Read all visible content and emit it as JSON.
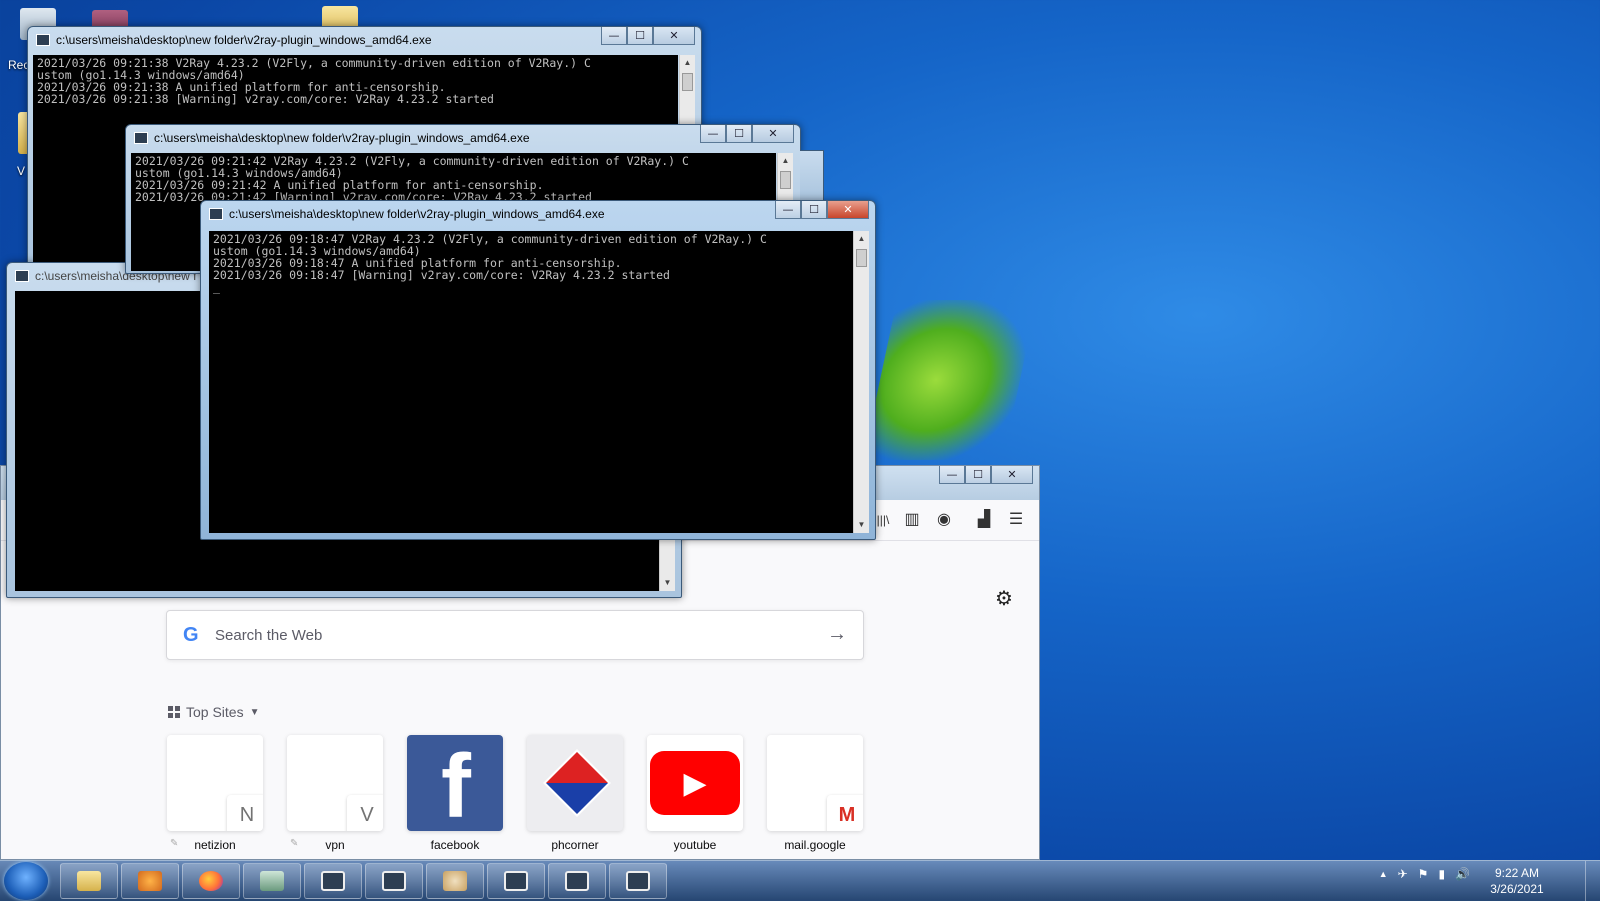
{
  "desktop": {
    "icon_labels": [
      "Rec",
      "V"
    ]
  },
  "console_windows": [
    {
      "title": "c:\\users\\meisha\\desktop\\new folder\\v2ray-plugin_windows_amd64.exe",
      "lines": [
        "2021/03/26 09:21:38 V2Ray 4.23.2 (V2Fly, a community-driven edition of V2Ray.) C",
        "ustom (go1.14.3 windows/amd64)",
        "2021/03/26 09:21:38 A unified platform for anti-censorship.",
        "2021/03/26 09:21:38 [Warning] v2ray.com/core: V2Ray 4.23.2 started"
      ]
    },
    {
      "title": "c:\\users\\meisha\\desktop\\new folder\\v2ray-plugin_windows_amd64.exe",
      "lines": [
        "2021/03/26 09:21:42 V2Ray 4.23.2 (V2Fly, a community-driven edition of V2Ray.) C",
        "ustom (go1.14.3 windows/amd64)",
        "2021/03/26 09:21:42 A unified platform for anti-censorship.",
        "2021/03/26 09:21:42 [Warning] v2ray.com/core: V2Ray 4.23.2 started"
      ]
    },
    {
      "title": "c:\\users\\meisha\\desktop\\new f",
      "lines": []
    },
    {
      "title": "c:\\users\\meisha\\desktop\\new folder\\v2ray-plugin_windows_amd64.exe",
      "lines": [
        "2021/03/26 09:18:47 V2Ray 4.23.2 (V2Fly, a community-driven edition of V2Ray.) C",
        "ustom (go1.14.3 windows/amd64)",
        "2021/03/26 09:18:47 A unified platform for anti-censorship.",
        "2021/03/26 09:18:47 [Warning] v2ray.com/core: V2Ray 4.23.2 started",
        "_"
      ]
    }
  ],
  "window_buttons": {
    "minimize": "—",
    "maximize": "☐",
    "close": "✕"
  },
  "firefox": {
    "search": {
      "google_glyph": "G",
      "placeholder": "Search the Web",
      "arrow": "→"
    },
    "top_sites": {
      "heading": "Top Sites",
      "tiles": [
        {
          "label": "netizion",
          "letter": "N"
        },
        {
          "label": "vpn",
          "letter": "V"
        },
        {
          "label": "facebook",
          "letter": "f"
        },
        {
          "label": "phcorner",
          "letter": ""
        },
        {
          "label": "youtube",
          "letter": "▶"
        },
        {
          "label": "mail.google",
          "letter": "M"
        }
      ]
    },
    "toolbar_icons": [
      "library-icon",
      "sidebar-icon",
      "account-icon",
      "extensions-icon",
      "menu-icon"
    ],
    "toolbar_glyphs": {
      "library": "|||\\",
      "sidebar": "▥",
      "account": "◉",
      "extensions": "▟",
      "menu": "☰"
    },
    "gear_glyph": "⚙"
  },
  "taskbar": {
    "clock_time": "9:22 AM",
    "clock_date": "3/26/2021",
    "tray_glyphs": [
      "▲",
      "✈",
      "⚑",
      "▮",
      "🔊"
    ]
  },
  "colors": {
    "desktop_blue": "#1565c8",
    "console_bg": "#000000",
    "youtube_red": "#ff0000",
    "facebook_blue": "#3b5998",
    "gmail_red": "#d93025"
  }
}
